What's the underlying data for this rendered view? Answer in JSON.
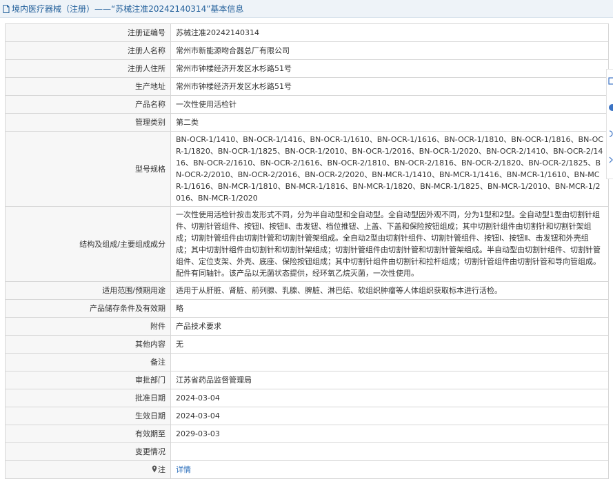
{
  "header": {
    "title": "境内医疗器械（注册）——“苏械注准20242140314”基本信息"
  },
  "rows": [
    {
      "label": "注册证编号",
      "value": "苏械注准20242140314"
    },
    {
      "label": "注册人名称",
      "value": "常州市新能源吻合器总厂有限公司"
    },
    {
      "label": "注册人住所",
      "value": "常州市钟楼经济开发区水杉路51号"
    },
    {
      "label": "生产地址",
      "value": "常州市钟楼经济开发区水杉路51号"
    },
    {
      "label": "产品名称",
      "value": "一次性使用活检针"
    },
    {
      "label": "管理类别",
      "value": "第二类"
    },
    {
      "label": "型号规格",
      "value": "BN-OCR-1/1410、BN-OCR-1/1416、BN-OCR-1/1610、BN-OCR-1/1616、BN-OCR-1/1810、BN-OCR-1/1816、BN-OCR-1/1820、BN-OCR-1/1825、BN-OCR-1/2010、BN-OCR-1/2016、BN-OCR-1/2020、BN-OCR-2/1410、BN-OCR-2/1416、BN-OCR-2/1610、BN-OCR-2/1616、BN-OCR-2/1810、BN-OCR-2/1816、BN-OCR-2/1820、BN-OCR-2/1825、BN-OCR-2/2010、BN-OCR-2/2016、BN-OCR-2/2020、BN-MCR-1/1410、BN-MCR-1/1416、BN-MCR-1/1610、BN-MCR-1/1616、BN-MCR-1/1810、BN-MCR-1/1816、BN-MCR-1/1820、BN-MCR-1/1825、BN-MCR-1/2010、BN-MCR-1/2016、BN-MCR-1/2020"
    },
    {
      "label": "结构及组成/主要组成成分",
      "value": "一次性使用活检针按击发形式不同，分为半自动型和全自动型。全自动型因外观不同，分为1型和2型。全自动型1型由切割针组件、切割针管组件、按钮Ⅰ、按钮Ⅱ、击发钮、档位推钮、上盖、下盖和保险按钮组成；其中切割针组件由切割针和切割针架组成；切割针管组件由切割针管和切割针管架组成。全自动2型由切割针组件、切割针管组件、按钮Ⅰ、按钮Ⅱ、击发钮和外壳组成；其中切割针组件由切割针和切割针架组成；切割针管组件由切割针管和切割针管架组成。半自动型由切割针组件、切割针管组件、定位支架、外壳、底座、保险按钮组成；其中切割针组件由切割针和拉杆组成；切割针管组件由切割针管和导向管组成。配件有同轴针。该产品以无菌状态提供，经环氧乙烷灭菌，一次性使用。"
    },
    {
      "label": "适用范围/预期用途",
      "value": "适用于从肝脏、肾脏、前列腺、乳腺、脾脏、淋巴结、软组织肿瘤等人体组织获取标本进行活检。"
    },
    {
      "label": "产品储存条件及有效期",
      "value": "略"
    },
    {
      "label": "附件",
      "value": "产品技术要求"
    },
    {
      "label": "其他内容",
      "value": "无"
    },
    {
      "label": "备注",
      "value": ""
    },
    {
      "label": "审批部门",
      "value": "江苏省药品监督管理局"
    },
    {
      "label": "批准日期",
      "value": "2024-03-04"
    },
    {
      "label": "生效日期",
      "value": "2024-03-04"
    },
    {
      "label": "有效期至",
      "value": "2029-03-03"
    },
    {
      "label": "变更情况",
      "value": ""
    }
  ],
  "note": {
    "label": "注",
    "link": "详情"
  },
  "icons": {
    "title": "document-icon",
    "note": "location-pin-icon"
  },
  "colors": {
    "title_text": "#215f9a",
    "link": "#2a6ebb",
    "label_bg": "#f7f7f7",
    "border": "#d6d6d6"
  }
}
